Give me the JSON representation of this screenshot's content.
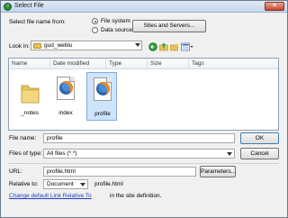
{
  "window": {
    "title": "Select File"
  },
  "selection": {
    "label": "Select file name from:",
    "options": [
      "File system",
      "Data sources"
    ],
    "selected_index": 0
  },
  "sites_button": "Sites and Servers...",
  "look_in": {
    "label": "Look in:",
    "value": "gud_weblu"
  },
  "columns": [
    "Name",
    "Date modified",
    "Type",
    "Size",
    "Tags"
  ],
  "files": [
    {
      "name": "_notes",
      "icon": "folder-icon",
      "selected": false
    },
    {
      "name": "index",
      "icon": "firefox-html-icon",
      "selected": false
    },
    {
      "name": "profile",
      "icon": "firefox-html-icon",
      "selected": true
    }
  ],
  "file_name": {
    "label": "File name:",
    "value": "profile"
  },
  "file_type": {
    "label": "Files of type:",
    "value": "All files (*.*)"
  },
  "url": {
    "label": "URL:",
    "value": "profile.html"
  },
  "parameters_button": "Parameters...",
  "relative": {
    "label": "Relative to:",
    "value": "Document",
    "path": "profile.html"
  },
  "link_text": "Change default Link Relative To",
  "link_suffix": "in the site definition.",
  "ok_button": "OK",
  "cancel_button": "Cancel",
  "colors": {
    "accent": "#1f5fb8",
    "selection": "#cde4fb",
    "link": "#1f3fbf"
  }
}
